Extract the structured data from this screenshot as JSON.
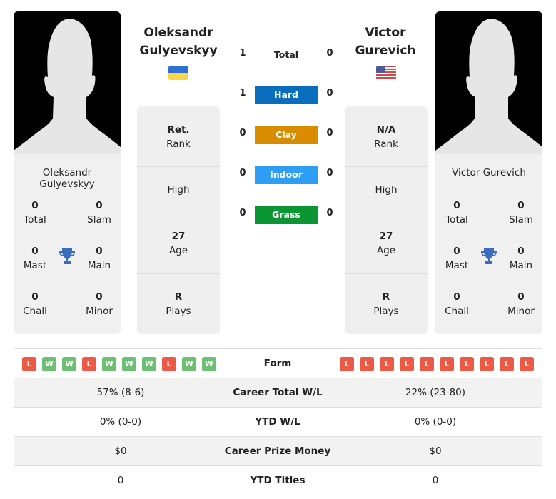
{
  "colors": {
    "hard": "#0a6ebd",
    "clay": "#d98c00",
    "indoor": "#2e9ef5",
    "grass": "#0c9633",
    "win": "#6cbf73",
    "loss": "#ec5a45",
    "trophy": "#3b6dbf"
  },
  "player1": {
    "name_line1": "Oleksandr",
    "name_line2": "Gulyevskyy",
    "full_name": "Oleksandr Gulyevskyy",
    "flag": "ukraine-flag",
    "titles": {
      "total": "0",
      "total_label": "Total",
      "slam": "0",
      "slam_label": "Slam",
      "mast": "0",
      "mast_label": "Mast",
      "main": "0",
      "main_label": "Main",
      "chall": "0",
      "chall_label": "Chall",
      "minor": "0",
      "minor_label": "Minor"
    },
    "info": {
      "rank": "Ret.",
      "rank_label": "Rank",
      "high_label": "High",
      "age": "27",
      "age_label": "Age",
      "plays": "R",
      "plays_label": "Plays"
    }
  },
  "player2": {
    "name_line1": "Victor",
    "name_line2": "Gurevich",
    "full_name": "Victor Gurevich",
    "flag": "usa-flag",
    "titles": {
      "total": "0",
      "total_label": "Total",
      "slam": "0",
      "slam_label": "Slam",
      "mast": "0",
      "mast_label": "Mast",
      "main": "0",
      "main_label": "Main",
      "chall": "0",
      "chall_label": "Chall",
      "minor": "0",
      "minor_label": "Minor"
    },
    "info": {
      "rank": "N/A",
      "rank_label": "Rank",
      "high_label": "High",
      "age": "27",
      "age_label": "Age",
      "plays": "R",
      "plays_label": "Plays"
    }
  },
  "h2h": {
    "total": {
      "label": "Total",
      "p1": "1",
      "p2": "0"
    },
    "hard": {
      "label": "Hard",
      "p1": "1",
      "p2": "0"
    },
    "clay": {
      "label": "Clay",
      "p1": "0",
      "p2": "0"
    },
    "indoor": {
      "label": "Indoor",
      "p1": "0",
      "p2": "0"
    },
    "grass": {
      "label": "Grass",
      "p1": "0",
      "p2": "0"
    }
  },
  "comparison": {
    "form_label": "Form",
    "p1_form": [
      "L",
      "W",
      "W",
      "L",
      "W",
      "W",
      "W",
      "L",
      "W",
      "W"
    ],
    "p2_form": [
      "L",
      "L",
      "L",
      "L",
      "L",
      "L",
      "L",
      "L",
      "L",
      "L"
    ],
    "rows": [
      {
        "label": "Career Total W/L",
        "p1": "57% (8-6)",
        "p2": "22% (23-80)"
      },
      {
        "label": "YTD W/L",
        "p1": "0% (0-0)",
        "p2": "0% (0-0)"
      },
      {
        "label": "Career Prize Money",
        "p1": "$0",
        "p2": "$0"
      },
      {
        "label": "YTD Titles",
        "p1": "0",
        "p2": "0"
      }
    ]
  }
}
